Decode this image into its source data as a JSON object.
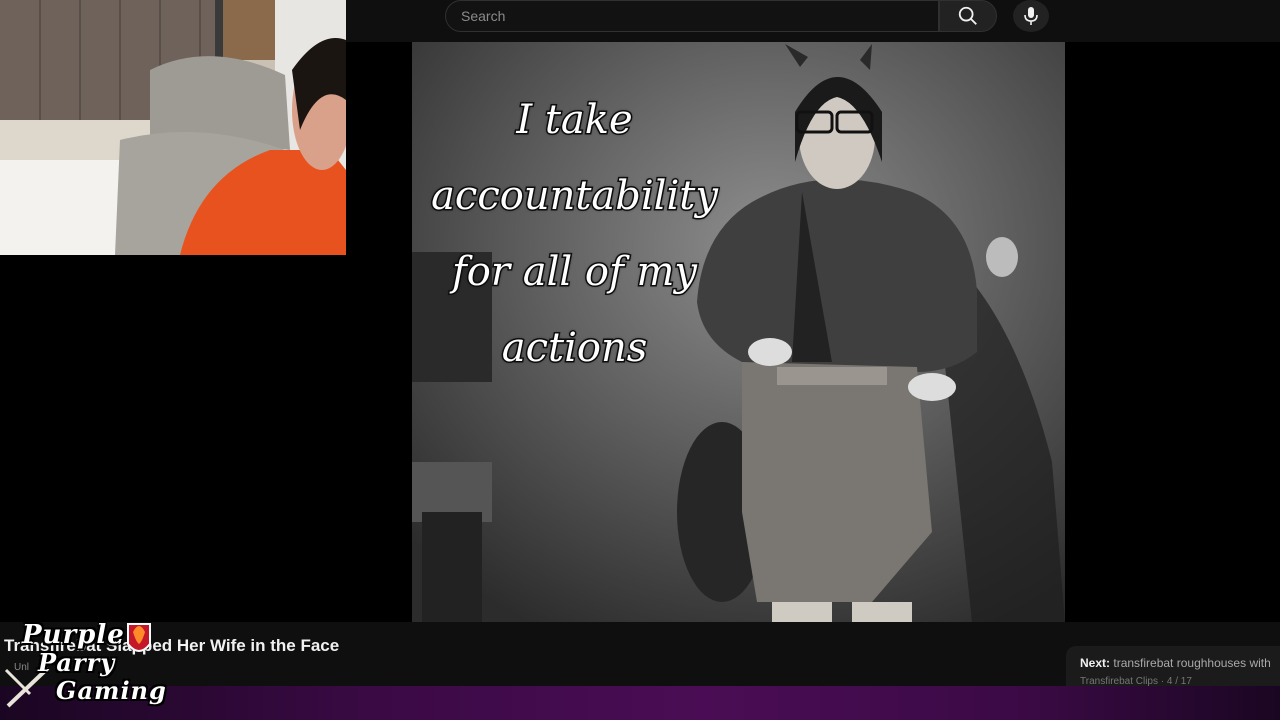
{
  "search": {
    "placeholder": "Search"
  },
  "icons": {
    "search": "search-icon",
    "mic": "microphone-icon"
  },
  "meme": {
    "caption": "I take accountability for all of my actions"
  },
  "video": {
    "title": "Transfirebat Slapped Her Wife in the Face",
    "subtitle": "Unl"
  },
  "up_next": {
    "label": "Next:",
    "title": "transfirebat roughhouses with",
    "playlist": "Transfirebat Clips · 4 / 17"
  },
  "logo": {
    "line1": "Purple",
    "line2": "Parry",
    "line3": "Gaming"
  },
  "colors": {
    "accent_purple": "#4a0d55",
    "background": "#0f0f0f"
  }
}
